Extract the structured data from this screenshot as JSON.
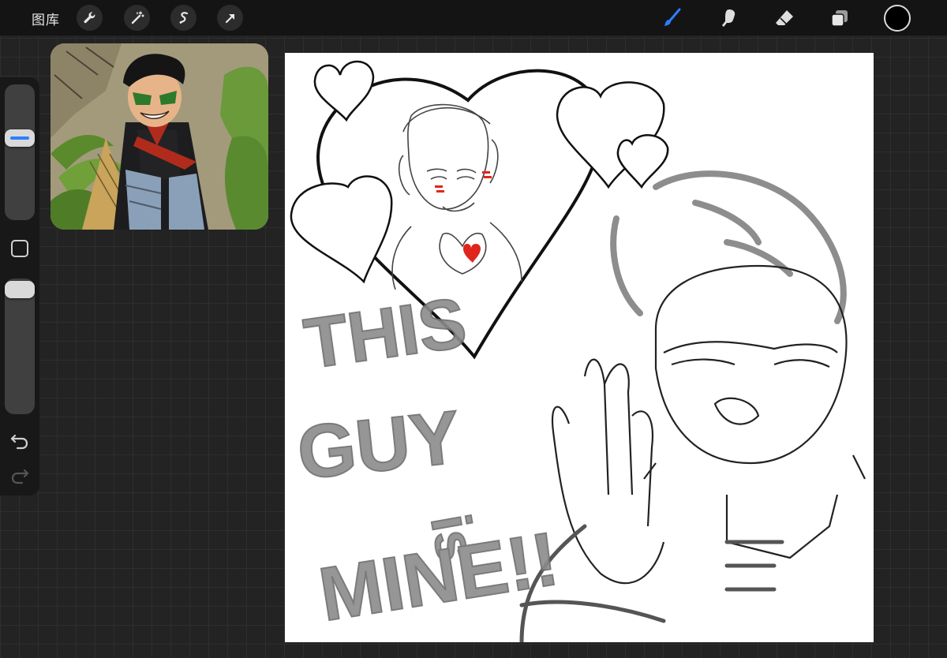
{
  "topbar": {
    "gallery_label": "图库",
    "tools_left": [
      {
        "name": "wrench-icon",
        "label": "actions"
      },
      {
        "name": "magic-wand-icon",
        "label": "adjustments"
      },
      {
        "name": "selection-icon",
        "label": "selection"
      },
      {
        "name": "transform-arrow-icon",
        "label": "transform"
      }
    ],
    "tools_right": [
      {
        "name": "brush-icon",
        "active": true
      },
      {
        "name": "smudge-icon",
        "active": false
      },
      {
        "name": "eraser-icon",
        "active": false
      },
      {
        "name": "layers-icon",
        "active": false
      }
    ],
    "active_color": "#000000"
  },
  "colors": {
    "accent_blue": "#2c7fff",
    "canvas_bg": "#ffffff",
    "ui_bg": "#141414"
  },
  "sidebar": {
    "brush_size_level": 0.72,
    "opacity_level": 1.0
  },
  "canvas": {
    "drawn_text": [
      "THIS",
      "GUY",
      "is",
      "MINE!!"
    ]
  }
}
